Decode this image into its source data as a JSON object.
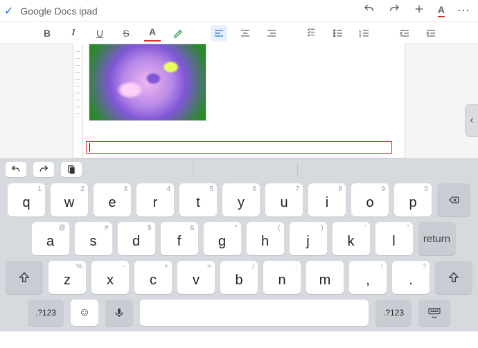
{
  "header": {
    "title": "Google Docs ipad",
    "font_color_label": "A"
  },
  "fmt": {
    "bold": "B",
    "italic": "I",
    "underline": "U",
    "strike": "S",
    "text_color": "A"
  },
  "edge_tab": {
    "glyph": "‹"
  },
  "keyboard": {
    "row1": [
      {
        "sec": "1",
        "main": "q"
      },
      {
        "sec": "2",
        "main": "w"
      },
      {
        "sec": "3",
        "main": "e"
      },
      {
        "sec": "4",
        "main": "r"
      },
      {
        "sec": "5",
        "main": "t"
      },
      {
        "sec": "6",
        "main": "y"
      },
      {
        "sec": "7",
        "main": "u"
      },
      {
        "sec": "8",
        "main": "i"
      },
      {
        "sec": "9",
        "main": "o"
      },
      {
        "sec": "0",
        "main": "p"
      }
    ],
    "row2": [
      {
        "sec": "@",
        "main": "a"
      },
      {
        "sec": "#",
        "main": "s"
      },
      {
        "sec": "$",
        "main": "d"
      },
      {
        "sec": "&",
        "main": "f"
      },
      {
        "sec": "*",
        "main": "g"
      },
      {
        "sec": "(",
        "main": "h"
      },
      {
        "sec": ")",
        "main": "j"
      },
      {
        "sec": "'",
        "main": "k"
      },
      {
        "sec": "\"",
        "main": "l"
      }
    ],
    "row3": [
      {
        "sec": "%",
        "main": "z"
      },
      {
        "sec": "-",
        "main": "x"
      },
      {
        "sec": "+",
        "main": "c"
      },
      {
        "sec": "=",
        "main": "v"
      },
      {
        "sec": "/",
        "main": "b"
      },
      {
        "sec": ";",
        "main": "n"
      },
      {
        "sec": ":",
        "main": "m"
      },
      {
        "sec": "!",
        "main": ","
      },
      {
        "sec": "?",
        "main": "."
      }
    ],
    "return_label": "return",
    "mode_label": ".?123"
  }
}
